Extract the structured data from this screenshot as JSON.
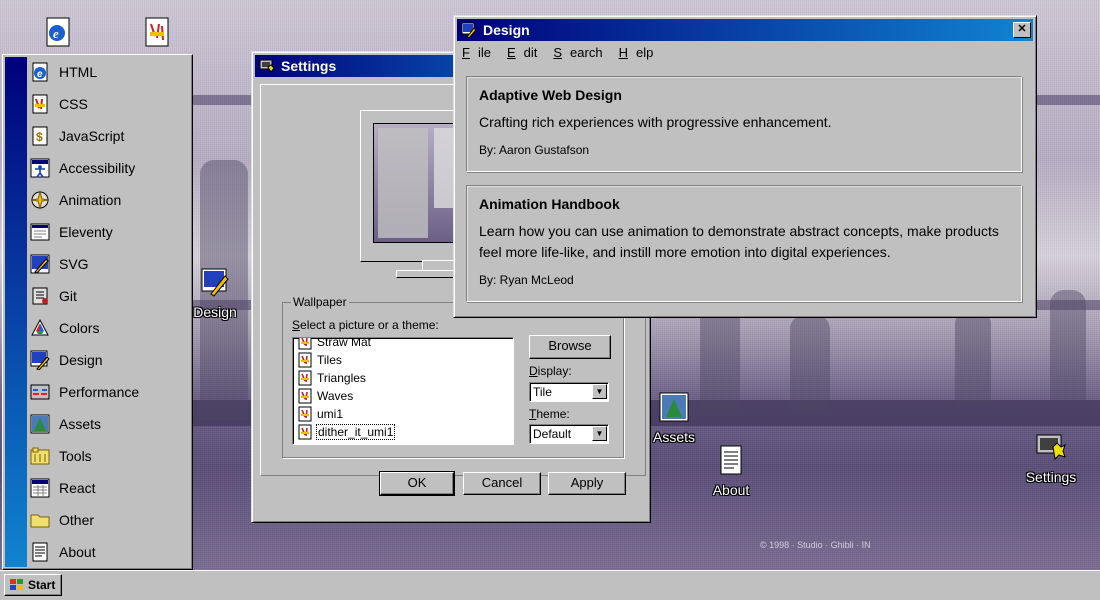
{
  "desktop": {
    "icons": [
      {
        "label": "",
        "icon": "ie-icon"
      },
      {
        "label": "",
        "icon": "css-icon"
      },
      {
        "label": "Design",
        "icon": "design-icon"
      },
      {
        "label": "Assets",
        "icon": "assets-icon"
      },
      {
        "label": "About",
        "icon": "about-icon"
      },
      {
        "label": "Settings",
        "icon": "settings-icon"
      }
    ],
    "wallpaper_credit": "© 1998 · Studio · Ghibli · IN"
  },
  "start_menu": {
    "items": [
      {
        "label": "HTML",
        "icon": "ie-icon"
      },
      {
        "label": "CSS",
        "icon": "css-icon"
      },
      {
        "label": "JavaScript",
        "icon": "javascript-icon"
      },
      {
        "label": "Accessibility",
        "icon": "accessibility-icon"
      },
      {
        "label": "Animation",
        "icon": "animation-icon"
      },
      {
        "label": "Eleventy",
        "icon": "eleventy-icon"
      },
      {
        "label": "SVG",
        "icon": "svg-icon"
      },
      {
        "label": "Git",
        "icon": "git-icon"
      },
      {
        "label": "Colors",
        "icon": "colors-icon"
      },
      {
        "label": "Design",
        "icon": "design-icon"
      },
      {
        "label": "Performance",
        "icon": "performance-icon"
      },
      {
        "label": "Assets",
        "icon": "assets-icon"
      },
      {
        "label": "Tools",
        "icon": "tools-icon"
      },
      {
        "label": "React",
        "icon": "react-icon"
      },
      {
        "label": "Other",
        "icon": "folder-icon"
      },
      {
        "label": "About",
        "icon": "about-icon"
      }
    ]
  },
  "taskbar": {
    "start_label": "Start"
  },
  "settings_window": {
    "title": "Settings",
    "wallpaper_group": "Wallpaper",
    "select_label_prefix": "S",
    "select_label_rest": "elect a picture or a theme:",
    "wallpapers": [
      "Straw Mat",
      "Tiles",
      "Triangles",
      "Waves",
      "umi1",
      "dither_it_umi1"
    ],
    "selected_wallpaper": "dither_it_umi1",
    "browse_label": "Browse",
    "display_label_prefix": "D",
    "display_label_rest": "isplay:",
    "display_value": "Tile",
    "theme_label_prefix": "T",
    "theme_label_rest": "heme:",
    "theme_value": "Default",
    "ok_label": "OK",
    "cancel_label": "Cancel",
    "apply_label": "Apply"
  },
  "design_window": {
    "title": "Design",
    "menu": [
      {
        "u": "F",
        "rest": "ile"
      },
      {
        "u": "E",
        "rest": "dit"
      },
      {
        "u": "S",
        "rest": "earch"
      },
      {
        "u": "H",
        "rest": "elp"
      }
    ],
    "cards": [
      {
        "title": "Adaptive Web Design",
        "description": "Crafting rich experiences with progressive enhancement.",
        "author": "By: Aaron Gustafson"
      },
      {
        "title": "Animation Handbook",
        "description": "Learn how you can use animation to demonstrate abstract concepts, make products feel more life-like, and instill more emotion into digital experiences.",
        "author": "By: Ryan McLeod"
      }
    ],
    "close_label": "✕"
  },
  "colors": {
    "title_active": "#00007b",
    "title_gradient_end": "#1084d0",
    "window_face": "#c0c0c0"
  }
}
